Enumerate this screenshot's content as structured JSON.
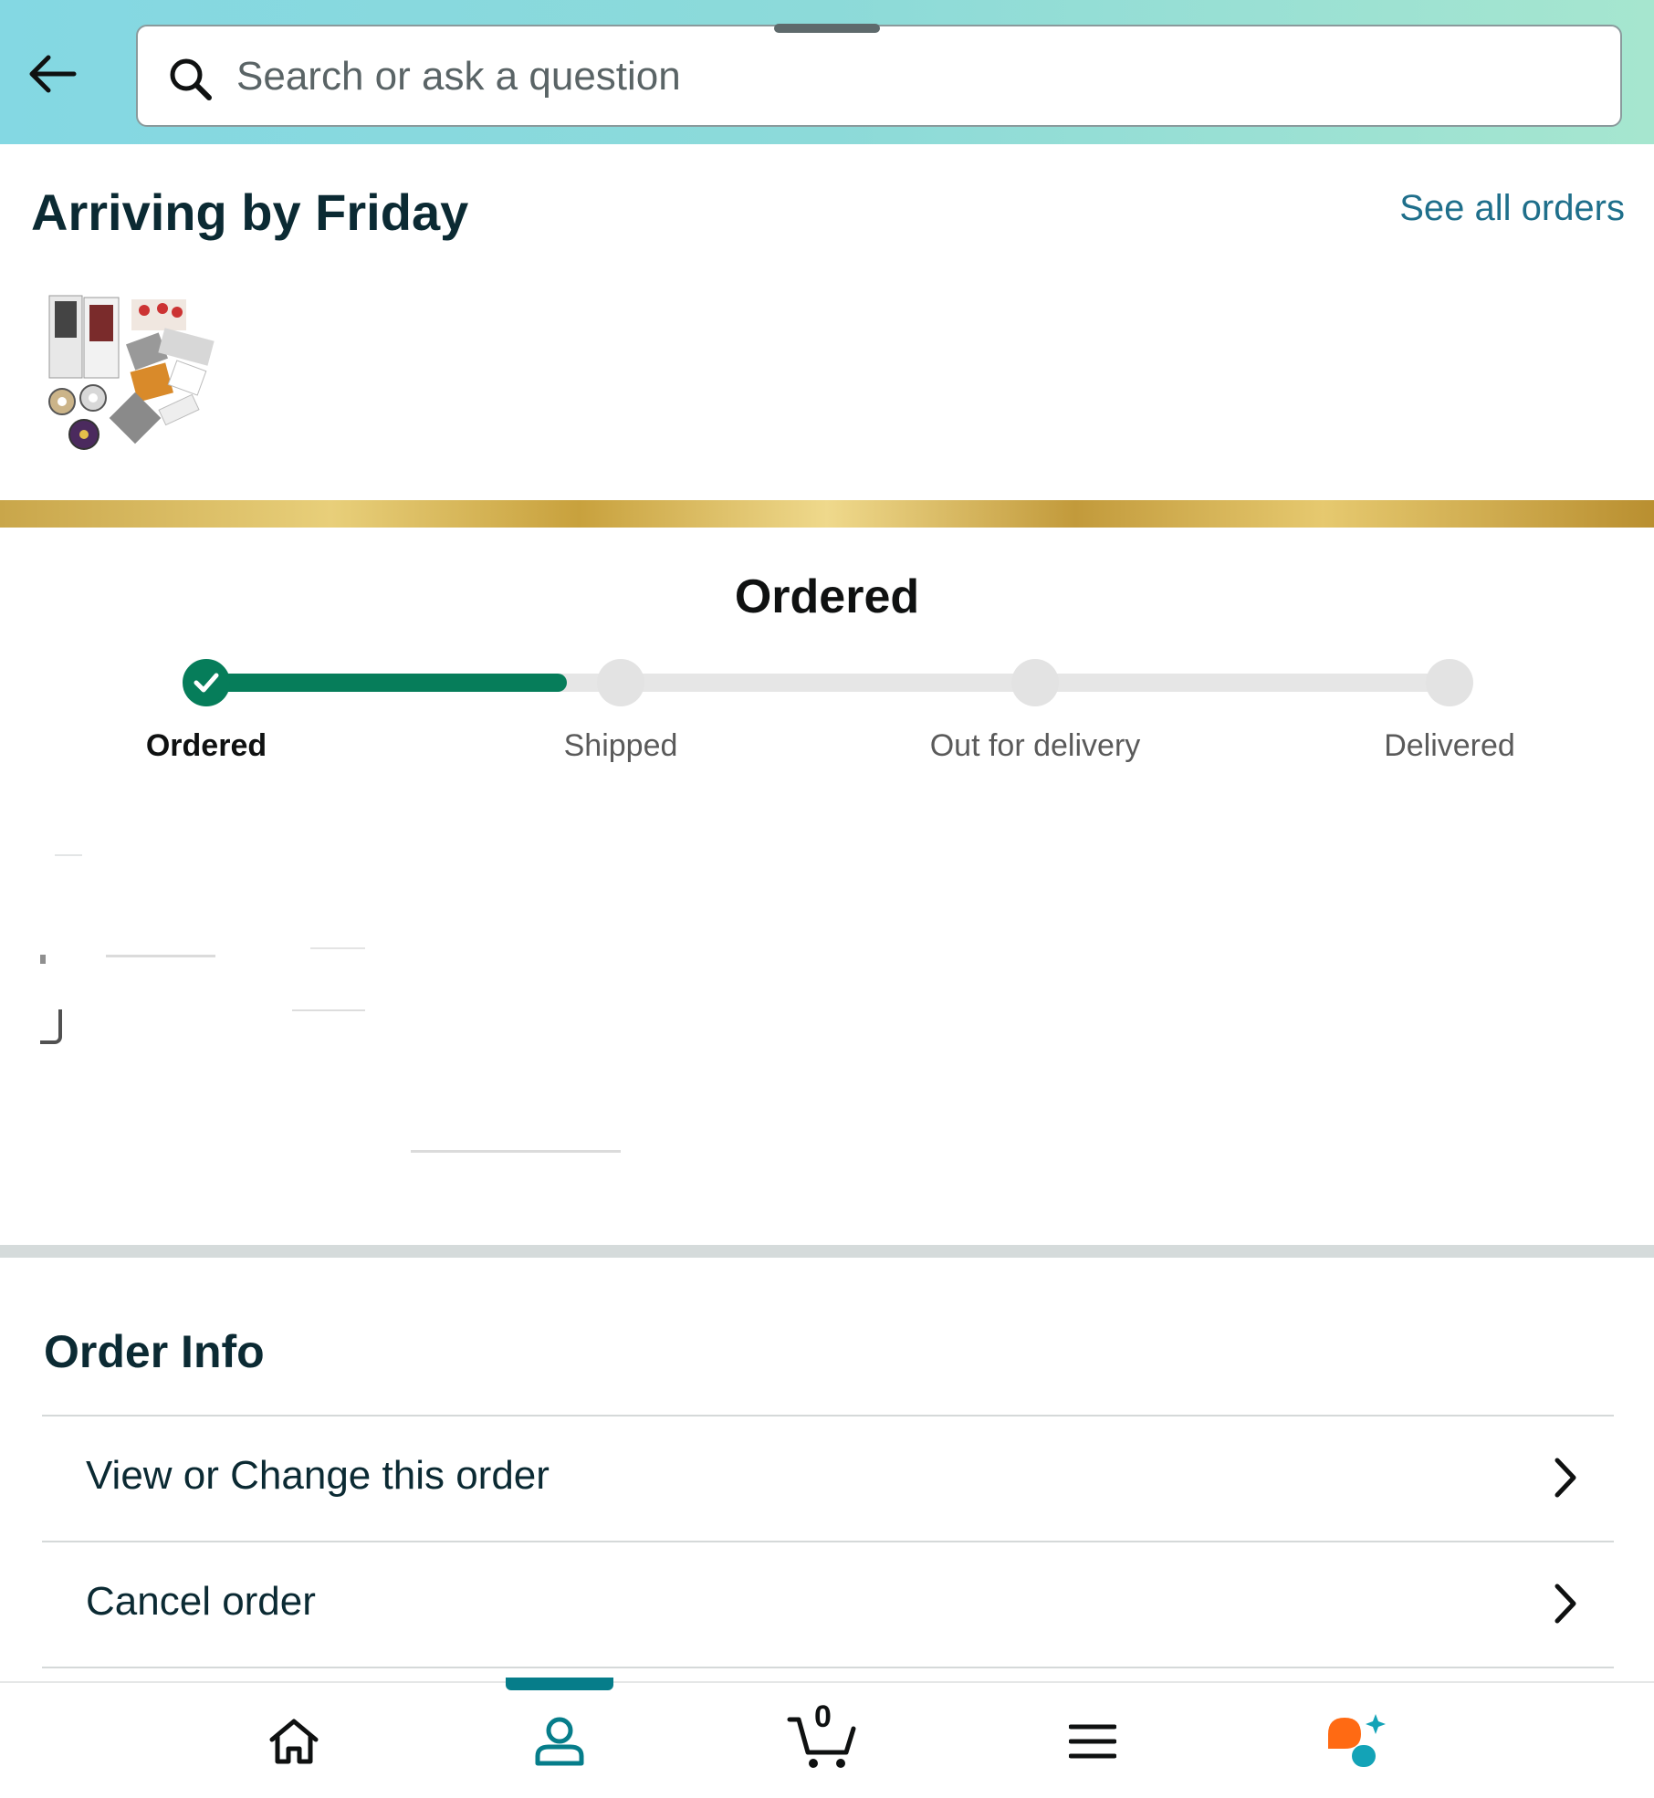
{
  "header": {
    "search_placeholder": "Search or ask a question"
  },
  "arriving": {
    "title": "Arriving by Friday",
    "see_all_label": "See all orders"
  },
  "tracking": {
    "status_title": "Ordered",
    "progress": 0.25,
    "steps": [
      {
        "label": "Ordered",
        "state": "complete"
      },
      {
        "label": "Shipped",
        "state": "pending"
      },
      {
        "label": "Out for delivery",
        "state": "pending"
      },
      {
        "label": "Delivered",
        "state": "pending"
      }
    ],
    "accent_color": "#067d5a"
  },
  "order_info": {
    "title": "Order Info",
    "rows": [
      {
        "label": "View or Change this order"
      },
      {
        "label": "Cancel order"
      }
    ]
  },
  "bottom_nav": {
    "items": [
      {
        "icon": "home-icon"
      },
      {
        "icon": "account-icon",
        "selected": true
      },
      {
        "icon": "cart-icon",
        "count": "0"
      },
      {
        "icon": "menu-icon"
      },
      {
        "icon": "assistant-icon"
      }
    ]
  },
  "colors": {
    "header_start": "#84d8e3",
    "header_end": "#a6e6cf",
    "link": "#1f6f8b",
    "selected_nav": "#067d8a"
  }
}
